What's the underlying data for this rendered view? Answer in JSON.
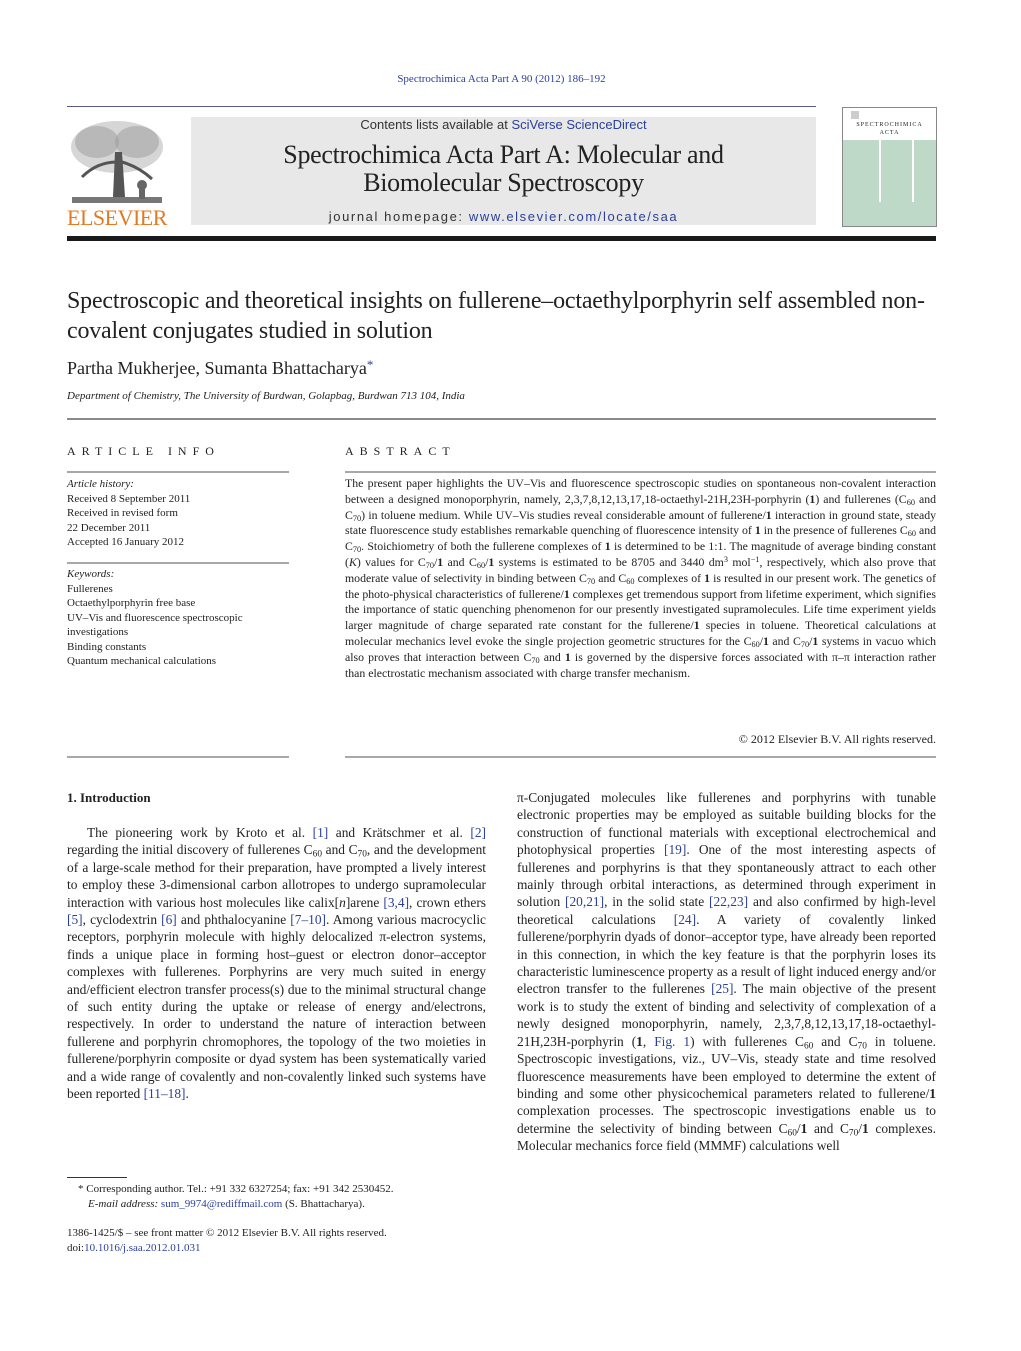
{
  "header": {
    "citation": "Spectrochimica Acta Part A 90 (2012) 186–192",
    "publisher_logo_text": "ELSEVIER",
    "contents_prefix": "Contents lists available at ",
    "contents_link": "SciVerse ScienceDirect",
    "journal_title_line1": "Spectrochimica Acta Part A: Molecular and",
    "journal_title_line2": "Biomolecular Spectroscopy",
    "homepage_prefix": "journal homepage: ",
    "homepage_link": "www.elsevier.com/locate/saa",
    "cover_title_line1": "SPECTROCHIMICA",
    "cover_title_line2": "ACTA",
    "colors": {
      "link": "#2a3f9a",
      "elsevier_orange": "#e07b24",
      "header_bg": "#e8e8e8",
      "cover_green": "#bfd9c8"
    }
  },
  "article": {
    "title": "Spectroscopic and theoretical insights on fullerene–octaethylporphyrin self assembled non-covalent conjugates studied in solution",
    "authors": "Partha Mukherjee, Sumanta Bhattacharya",
    "author_mark": "*",
    "affiliation": "Department of Chemistry, The University of Burdwan, Golapbag, Burdwan 713 104, India"
  },
  "article_info": {
    "heading": "ARTICLE INFO",
    "history_label": "Article history:",
    "history": [
      "Received 8 September 2011",
      "Received in revised form",
      "22 December 2011",
      "Accepted 16 January 2012"
    ],
    "keywords_label": "Keywords:",
    "keywords": [
      "Fullerenes",
      "Octaethylporphyrin free base",
      "UV–Vis and fluorescence spectroscopic",
      "investigations",
      "Binding constants",
      "Quantum mechanical calculations"
    ]
  },
  "abstract": {
    "heading": "ABSTRACT",
    "copyright": "© 2012 Elsevier B.V. All rights reserved."
  },
  "introduction": {
    "heading": "1.  Introduction"
  },
  "footnotes": {
    "corresponding": "*  Corresponding author. Tel.: +91 332 6327254; fax: +91 342 2530452.",
    "email_label": "E-mail address: ",
    "email": "sum_9974@rediffmail.com",
    "email_suffix": " (S. Bhattacharya).",
    "front_matter": "1386-1425/$ – see front matter © 2012 Elsevier B.V. All rights reserved.",
    "doi_prefix": "doi:",
    "doi": "10.1016/j.saa.2012.01.031"
  }
}
